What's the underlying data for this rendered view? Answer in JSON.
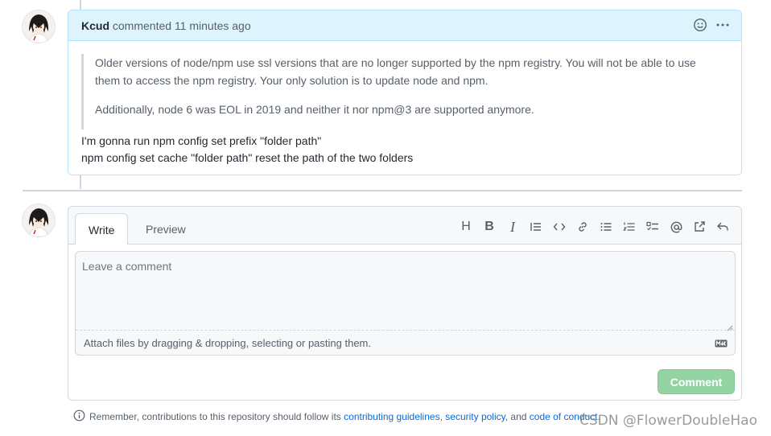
{
  "comment": {
    "author": "Kcud",
    "action_text": "commented",
    "timestamp": "11 minutes ago",
    "quote_paragraphs": [
      "Older versions of node/npm use ssl versions that are no longer supported by the npm registry. You will not be able to use them to access the npm registry. Your only solution is to update node and npm.",
      "Additionally, node 6 was EOL in 2019 and neither it nor npm@3 are supported anymore."
    ],
    "body_lines": [
      "I'm gonna run npm config set prefix \"folder path\"",
      "npm config set cache \"folder path\" reset the path of the two folders"
    ],
    "header_icons": [
      "smiley-icon",
      "kebab-menu-icon"
    ]
  },
  "new_comment": {
    "tabs": [
      "Write",
      "Preview"
    ],
    "active_tab": "Write",
    "toolbar": {
      "heading": "H",
      "bold": "B",
      "italic": "I",
      "icons": [
        "heading-icon",
        "bold-icon",
        "italic-icon",
        "quote-icon",
        "code-icon",
        "link-icon",
        "unordered-list-icon",
        "ordered-list-icon",
        "task-list-icon",
        "mention-icon",
        "reference-icon",
        "reply-icon"
      ]
    },
    "placeholder": "Leave a comment",
    "value": "",
    "attach_text": "Attach files by dragging & dropping, selecting or pasting them.",
    "markdown_badge": "markdown-icon",
    "submit_label": "Comment",
    "submit_color": "#94d3a2"
  },
  "footer": {
    "prefix": "Remember, contributions to this repository should follow its",
    "link1": "contributing guidelines",
    "sep1": ",",
    "link2": "security policy",
    "sep2": ", and",
    "link3": "code of conduct",
    "suffix": "."
  },
  "watermark": "CSDN @FlowerDoubleHao",
  "colors": {
    "header_bg": "#ddf4ff",
    "header_border": "#b6e3ff",
    "link": "#0969da"
  }
}
